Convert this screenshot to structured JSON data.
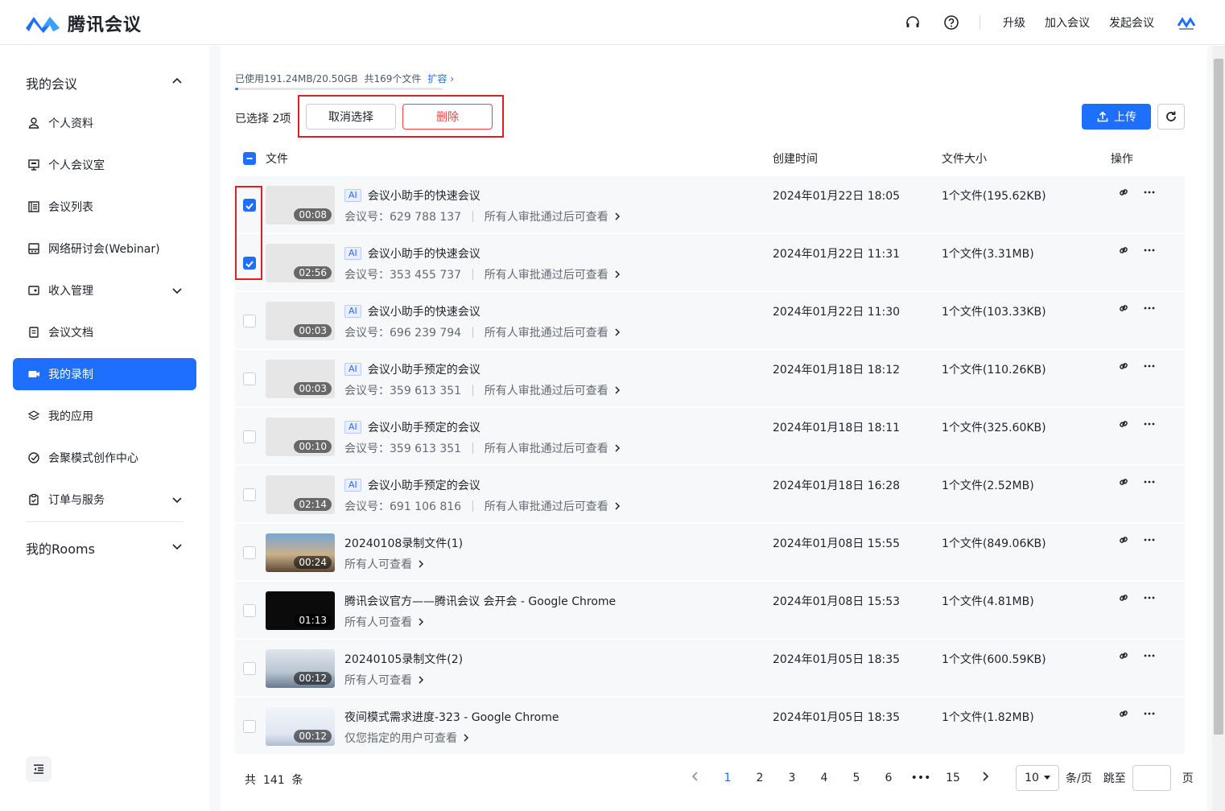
{
  "app": {
    "title": "腾讯会议"
  },
  "topbar": {
    "upgrade": "升级",
    "join": "加入会议",
    "start": "发起会议"
  },
  "sidebar": {
    "group1": "我的会议",
    "items": [
      {
        "label": "个人资料",
        "icon": "user-icon"
      },
      {
        "label": "个人会议室",
        "icon": "monitor-icon"
      },
      {
        "label": "会议列表",
        "icon": "list-icon"
      },
      {
        "label": "网络研讨会(Webinar)",
        "icon": "webinar-icon"
      },
      {
        "label": "收入管理",
        "icon": "wallet-icon"
      },
      {
        "label": "会议文档",
        "icon": "document-icon"
      },
      {
        "label": "我的录制",
        "icon": "video-icon"
      },
      {
        "label": "我的应用",
        "icon": "layers-icon"
      },
      {
        "label": "会聚模式创作中心",
        "icon": "creative-icon"
      },
      {
        "label": "订单与服务",
        "icon": "clipboard-icon"
      }
    ],
    "group2": "我的Rooms"
  },
  "storage": {
    "used": "已使用191.24MB/20.50GB",
    "count": "共169个文件",
    "expand": "扩容"
  },
  "toolbar": {
    "selected": "已选择 2项",
    "cancel": "取消选择",
    "delete": "删除",
    "upload": "上传"
  },
  "table": {
    "headers": {
      "file": "文件",
      "created": "创建时间",
      "size": "文件大小",
      "ops": "操作"
    },
    "ai_badge": "AI",
    "rows": [
      {
        "title": "会议小助手的快速会议",
        "ai": true,
        "sub1": "会议号：629 788 137",
        "sub2": "所有人审批通过后可查看",
        "duration": "00:08",
        "created": "2024年01月22日 18:05",
        "size": "1个文件(195.62KB)",
        "checked": true,
        "thumb": "gray"
      },
      {
        "title": "会议小助手的快速会议",
        "ai": true,
        "sub1": "会议号：353 455 737",
        "sub2": "所有人审批通过后可查看",
        "duration": "02:56",
        "created": "2024年01月22日 11:31",
        "size": "1个文件(3.31MB)",
        "checked": true,
        "thumb": "gray"
      },
      {
        "title": "会议小助手的快速会议",
        "ai": true,
        "sub1": "会议号：696 239 794",
        "sub2": "所有人审批通过后可查看",
        "duration": "00:03",
        "created": "2024年01月22日 11:30",
        "size": "1个文件(103.33KB)",
        "checked": false,
        "thumb": "gray"
      },
      {
        "title": "会议小助手预定的会议",
        "ai": true,
        "sub1": "会议号：359 613 351",
        "sub2": "所有人审批通过后可查看",
        "duration": "00:03",
        "created": "2024年01月18日 18:12",
        "size": "1个文件(110.26KB)",
        "checked": false,
        "thumb": "gray"
      },
      {
        "title": "会议小助手预定的会议",
        "ai": true,
        "sub1": "会议号：359 613 351",
        "sub2": "所有人审批通过后可查看",
        "duration": "00:10",
        "created": "2024年01月18日 18:11",
        "size": "1个文件(325.60KB)",
        "checked": false,
        "thumb": "gray"
      },
      {
        "title": "会议小助手预定的会议",
        "ai": true,
        "sub1": "会议号：691 106 816",
        "sub2": "所有人审批通过后可查看",
        "duration": "02:14",
        "created": "2024年01月18日 16:28",
        "size": "1个文件(2.52MB)",
        "checked": false,
        "thumb": "gray"
      },
      {
        "title": "20240108录制文件(1)",
        "ai": false,
        "sub1": "",
        "sub2": "所有人可查看",
        "duration": "00:24",
        "created": "2024年01月08日 15:55",
        "size": "1个文件(849.06KB)",
        "checked": false,
        "thumb": "sunset"
      },
      {
        "title": "腾讯会议官方——腾讯会议 会开会 - Google Chrome",
        "ai": false,
        "sub1": "",
        "sub2": "所有人可查看",
        "duration": "01:13",
        "created": "2024年01月08日 15:53",
        "size": "1个文件(4.81MB)",
        "checked": false,
        "thumb": "black"
      },
      {
        "title": "20240105录制文件(2)",
        "ai": false,
        "sub1": "",
        "sub2": "所有人可查看",
        "duration": "00:12",
        "created": "2024年01月05日 18:35",
        "size": "1个文件(600.59KB)",
        "checked": false,
        "thumb": "office"
      },
      {
        "title": "夜间模式需求进度-323 - Google Chrome",
        "ai": false,
        "sub1": "",
        "sub2": "仅您指定的用户可查看",
        "duration": "00:12",
        "created": "2024年01月05日 18:35",
        "size": "1个文件(1.82MB)",
        "checked": false,
        "thumb": "screen"
      }
    ]
  },
  "pagination": {
    "total_prefix": "共",
    "total": "141",
    "total_suffix": "条",
    "pages": [
      "1",
      "2",
      "3",
      "4",
      "5",
      "6",
      "•••",
      "15"
    ],
    "page_size": "10",
    "per_page": "条/页",
    "jump": "跳至",
    "page_unit": "页"
  },
  "colors": {
    "accent": "#1f6fff",
    "danger": "#f53f3f",
    "highlight": "#e02020"
  }
}
